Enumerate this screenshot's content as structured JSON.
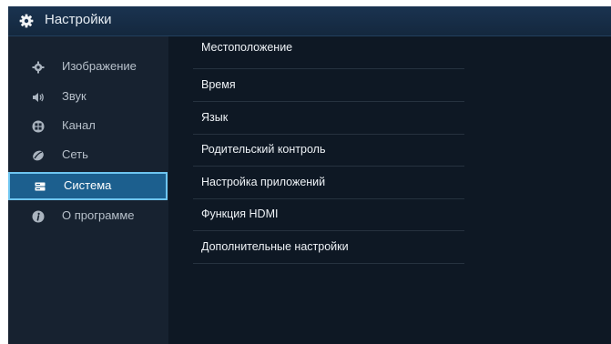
{
  "header": {
    "title": "Настройки",
    "icon": "gear-icon"
  },
  "sidebar": {
    "items": [
      {
        "label": "Изображение",
        "icon": "image-settings-icon"
      },
      {
        "label": "Звук",
        "icon": "speaker-icon"
      },
      {
        "label": "Канал",
        "icon": "grid-icon"
      },
      {
        "label": "Сеть",
        "icon": "network-icon"
      },
      {
        "label": "Система",
        "icon": "system-icon",
        "active": true
      },
      {
        "label": "О программе",
        "icon": "info-icon"
      }
    ]
  },
  "menu": {
    "items": [
      {
        "label": "Местоположение"
      },
      {
        "label": "Время"
      },
      {
        "label": "Язык"
      },
      {
        "label": "Родительский контроль"
      },
      {
        "label": "Настройка приложений"
      },
      {
        "label": "Функция HDMI"
      },
      {
        "label": "Дополнительные настройки"
      }
    ]
  },
  "colors": {
    "background": "#0e1824",
    "sidebar": "#172230",
    "header": "#1a3350",
    "active_fill": "#1c5f8e",
    "active_border": "#6ec5f0"
  }
}
